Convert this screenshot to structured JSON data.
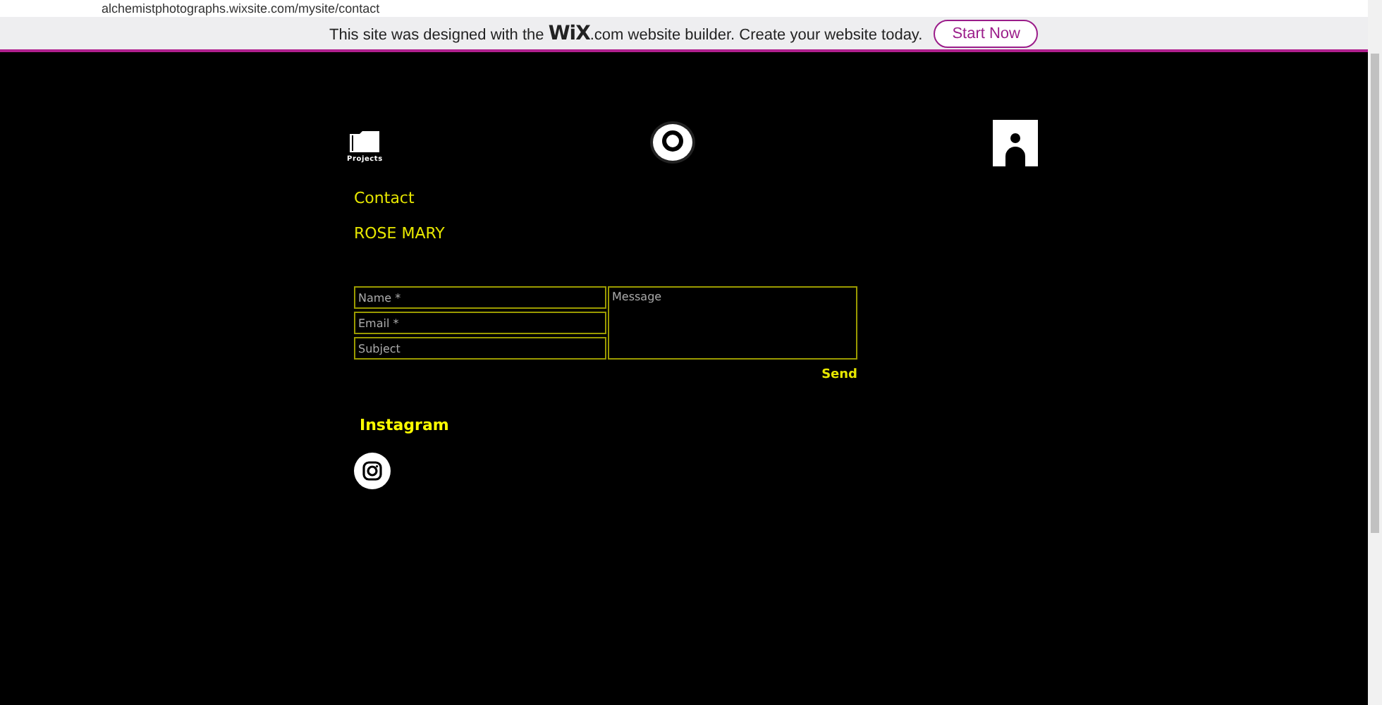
{
  "browser": {
    "url": "alchemistphotographs.wixsite.com/mysite/contact"
  },
  "banner": {
    "text_before": "This site was designed with the",
    "brand": "WiX",
    "text_after": ".com website builder. Create your website today.",
    "button": "Start Now"
  },
  "header": {
    "projects_label": "Projects"
  },
  "contact": {
    "title": "Contact",
    "name": "ROSE MARY"
  },
  "form": {
    "fields": [
      {
        "placeholder": "Name *"
      },
      {
        "placeholder": "Email *"
      },
      {
        "placeholder": "Subject"
      }
    ],
    "message": {
      "placeholder": "Message"
    },
    "submit": "Send"
  },
  "social": {
    "title": "Instagram"
  }
}
